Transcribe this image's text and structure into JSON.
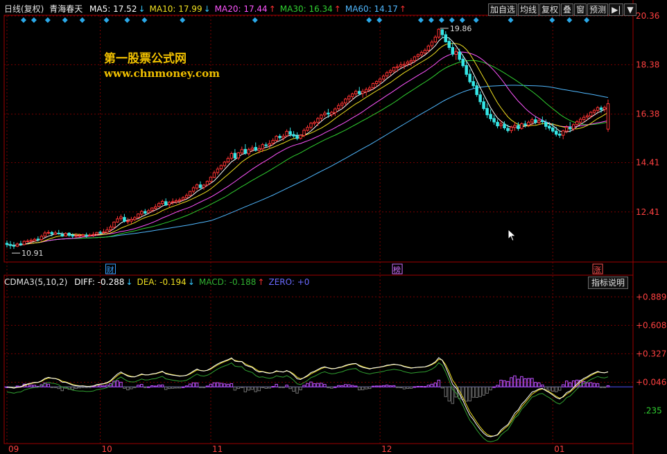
{
  "header": {
    "period_label": "日线(复权)",
    "stock_name": "青海春天",
    "ma_items": [
      {
        "label": "MA5: 17.52",
        "arrow": "↓",
        "color": "#ffffff",
        "arrow_color": "#35c9ff"
      },
      {
        "label": "MA10: 17.99",
        "arrow": "↓",
        "color": "#f0e020",
        "arrow_color": "#35c9ff"
      },
      {
        "label": "MA20: 17.44",
        "arrow": "↑",
        "color": "#ff55ff",
        "arrow_color": "#ff3030"
      },
      {
        "label": "MA30: 16.34",
        "arrow": "↑",
        "color": "#30d030",
        "arrow_color": "#ff3030"
      },
      {
        "label": "MA60: 14.17",
        "arrow": "↑",
        "color": "#50b8ff",
        "arrow_color": "#ff3030"
      }
    ]
  },
  "toolbar": {
    "buttons": [
      "加自选",
      "均线",
      "复权",
      "叠",
      "窗",
      "预测"
    ],
    "nav_icon": "arrow-right-bar-icon",
    "menu_icon": "dropdown-triangle-icon"
  },
  "promo": {
    "line1": "第一股票公式网",
    "line2": "www.chnmoney.com"
  },
  "price_axis": {
    "labels": [
      "20.36",
      "18.38",
      "16.38",
      "14.41",
      "12.41"
    ],
    "values": [
      20.36,
      18.38,
      16.38,
      14.41,
      12.41
    ],
    "range": [
      10.38,
      20.36
    ]
  },
  "annotations": {
    "high": {
      "text": "19.86",
      "value": 19.86
    },
    "low": {
      "text": "10.91",
      "value": 10.91
    }
  },
  "event_markers": [
    {
      "label": "财",
      "color": "#3aa0ff"
    },
    {
      "label": "榜",
      "color": "#d070ff"
    },
    {
      "label": "涨",
      "color": "#ff5050"
    }
  ],
  "indicator": {
    "name": "CDMA3(5,10,2)",
    "items": [
      {
        "label": "DIFF: -0.288",
        "arrow": "↓",
        "color": "#ffffff",
        "arrow_color": "#35c9ff"
      },
      {
        "label": "DEA: -0.194",
        "arrow": "↓",
        "color": "#f0e020",
        "arrow_color": "#35c9ff"
      },
      {
        "label": "MACD: -0.188",
        "arrow": "↑",
        "color": "#30b030",
        "arrow_color": "#ff3030"
      },
      {
        "label": "ZERO: +0",
        "arrow": "",
        "color": "#6a6aff",
        "arrow_color": "#6a6aff"
      }
    ],
    "explain_button": "指标说明",
    "axis": {
      "labels": [
        "+0.889",
        "+0.608",
        "+0.327",
        "+0.046"
      ],
      "values": [
        0.889,
        0.608,
        0.327,
        0.046
      ],
      "range": [
        -0.56,
        0.98
      ]
    },
    "extra_label": ".235"
  },
  "time_axis": {
    "labels": [
      "09",
      "10",
      "11",
      "12",
      "01"
    ],
    "label_index": [
      0,
      27,
      59,
      108,
      158
    ]
  },
  "colors": {
    "up": "#ff3232",
    "down": "#35e6e6",
    "grid": "#7a0000",
    "frame": "#a00000"
  },
  "chart_data": {
    "type": "candlestick",
    "title": "青海春天 日线(复权)",
    "candles": [
      [
        11.14,
        11.25,
        10.97,
        11.09
      ],
      [
        11.09,
        11.23,
        10.91,
        11.05
      ],
      [
        11.05,
        11.19,
        10.91,
        11.02
      ],
      [
        11.02,
        11.17,
        10.98,
        11.11
      ],
      [
        11.12,
        11.24,
        11.03,
        11.09
      ],
      [
        11.09,
        11.26,
        11.05,
        11.22
      ],
      [
        11.22,
        11.31,
        11.17,
        11.23
      ],
      [
        11.22,
        11.34,
        11.12,
        11.26
      ],
      [
        11.24,
        11.36,
        11.2,
        11.3
      ],
      [
        11.31,
        11.42,
        11.21,
        11.29
      ],
      [
        11.29,
        11.49,
        11.23,
        11.42
      ],
      [
        11.43,
        11.64,
        11.38,
        11.56
      ],
      [
        11.57,
        11.67,
        11.5,
        11.58
      ],
      [
        11.58,
        11.64,
        11.42,
        11.52
      ],
      [
        11.5,
        11.65,
        11.47,
        11.56
      ],
      [
        11.55,
        11.68,
        11.49,
        11.53
      ],
      [
        11.5,
        11.6,
        11.4,
        11.43
      ],
      [
        11.43,
        11.59,
        11.42,
        11.54
      ],
      [
        11.55,
        11.59,
        11.4,
        11.46
      ],
      [
        11.46,
        11.54,
        11.34,
        11.43
      ],
      [
        11.43,
        11.55,
        11.36,
        11.45
      ],
      [
        11.44,
        11.53,
        11.39,
        11.45
      ],
      [
        11.44,
        11.53,
        11.39,
        11.48
      ],
      [
        11.47,
        11.57,
        11.37,
        11.44
      ],
      [
        11.45,
        11.54,
        11.41,
        11.47
      ],
      [
        11.48,
        11.6,
        11.39,
        11.5
      ],
      [
        11.51,
        11.6,
        11.45,
        11.58
      ],
      [
        11.59,
        11.66,
        11.53,
        11.58
      ],
      [
        11.58,
        11.72,
        11.53,
        11.6
      ],
      [
        11.59,
        11.8,
        11.54,
        11.68
      ],
      [
        11.69,
        11.89,
        11.6,
        11.8
      ],
      [
        11.79,
        12.03,
        11.73,
        12.0
      ],
      [
        12.0,
        12.24,
        11.97,
        12.13
      ],
      [
        12.14,
        12.31,
        12.05,
        12.21
      ],
      [
        12.19,
        12.33,
        11.98,
        12.03
      ],
      [
        12.03,
        12.17,
        11.91,
        12.04
      ],
      [
        12.04,
        12.21,
        11.92,
        12.11
      ],
      [
        12.1,
        12.24,
        12.04,
        12.18
      ],
      [
        12.19,
        12.35,
        12.14,
        12.33
      ],
      [
        12.32,
        12.49,
        12.24,
        12.43
      ],
      [
        12.43,
        12.53,
        12.31,
        12.36
      ],
      [
        12.38,
        12.53,
        12.36,
        12.46
      ],
      [
        12.48,
        12.6,
        12.39,
        12.57
      ],
      [
        12.56,
        12.73,
        12.47,
        12.62
      ],
      [
        12.64,
        12.82,
        12.6,
        12.75
      ],
      [
        12.75,
        12.91,
        12.68,
        12.84
      ],
      [
        12.83,
        12.96,
        12.65,
        12.69
      ],
      [
        12.7,
        12.86,
        12.6,
        12.8
      ],
      [
        12.8,
        12.96,
        12.7,
        12.83
      ],
      [
        12.82,
        12.95,
        12.74,
        12.87
      ],
      [
        12.86,
        12.99,
        12.76,
        12.9
      ],
      [
        12.91,
        13.05,
        12.85,
        12.99
      ],
      [
        12.99,
        13.16,
        12.94,
        13.08
      ],
      [
        13.08,
        13.28,
        13.05,
        13.24
      ],
      [
        13.25,
        13.46,
        13.16,
        13.39
      ],
      [
        13.38,
        13.57,
        13.29,
        13.51
      ],
      [
        13.51,
        13.65,
        13.32,
        13.4
      ],
      [
        13.41,
        13.55,
        13.31,
        13.5
      ],
      [
        13.51,
        13.69,
        13.46,
        13.65
      ],
      [
        13.65,
        13.85,
        13.56,
        13.82
      ],
      [
        13.81,
        14.09,
        13.78,
        14.0
      ],
      [
        14.01,
        14.24,
        13.92,
        14.15
      ],
      [
        14.16,
        14.34,
        14.09,
        14.29
      ],
      [
        14.29,
        14.48,
        14.21,
        14.43
      ],
      [
        14.44,
        14.66,
        14.38,
        14.58
      ],
      [
        14.59,
        14.86,
        14.51,
        14.78
      ],
      [
        14.79,
        14.96,
        14.54,
        14.6
      ],
      [
        14.6,
        14.84,
        14.52,
        14.81
      ],
      [
        14.8,
        15.06,
        14.73,
        14.94
      ],
      [
        14.95,
        15.16,
        14.73,
        14.79
      ],
      [
        14.77,
        15.02,
        14.69,
        14.94
      ],
      [
        14.94,
        15.11,
        14.84,
        15.0
      ],
      [
        15.03,
        15.23,
        14.86,
        14.91
      ],
      [
        14.91,
        15.12,
        14.79,
        14.98
      ],
      [
        14.97,
        15.21,
        14.84,
        15.14
      ],
      [
        15.13,
        15.23,
        15.03,
        15.12
      ],
      [
        15.12,
        15.32,
        14.98,
        15.18
      ],
      [
        15.2,
        15.4,
        15.11,
        15.31
      ],
      [
        15.31,
        15.53,
        15.25,
        15.48
      ],
      [
        15.48,
        15.57,
        15.34,
        15.42
      ],
      [
        15.41,
        15.58,
        15.3,
        15.48
      ],
      [
        15.5,
        15.76,
        15.45,
        15.68
      ],
      [
        15.67,
        15.83,
        15.46,
        15.56
      ],
      [
        15.55,
        15.69,
        15.42,
        15.49
      ],
      [
        15.5,
        15.64,
        15.32,
        15.39
      ],
      [
        15.39,
        15.56,
        15.35,
        15.52
      ],
      [
        15.51,
        15.8,
        15.44,
        15.72
      ],
      [
        15.72,
        15.93,
        15.67,
        15.84
      ],
      [
        15.84,
        16.06,
        15.76,
        16.01
      ],
      [
        16.0,
        16.12,
        15.91,
        16.05
      ],
      [
        16.05,
        16.26,
        15.89,
        16.2
      ],
      [
        16.21,
        16.38,
        16.1,
        16.34
      ],
      [
        16.35,
        16.51,
        16.26,
        16.42
      ],
      [
        16.42,
        16.59,
        16.23,
        16.38
      ],
      [
        16.36,
        16.51,
        16.26,
        16.45
      ],
      [
        16.44,
        16.65,
        16.3,
        16.59
      ],
      [
        16.6,
        16.82,
        16.52,
        16.73
      ],
      [
        16.74,
        16.9,
        16.6,
        16.82
      ],
      [
        16.83,
        17.04,
        16.72,
        16.99
      ],
      [
        16.99,
        17.17,
        16.83,
        17.1
      ],
      [
        17.09,
        17.25,
        16.94,
        17.2
      ],
      [
        17.2,
        17.37,
        17.1,
        17.3
      ],
      [
        17.3,
        17.48,
        17.14,
        17.21
      ],
      [
        17.22,
        17.4,
        17.04,
        17.3
      ],
      [
        17.28,
        17.46,
        17.12,
        17.38
      ],
      [
        17.37,
        17.53,
        17.29,
        17.44
      ],
      [
        17.45,
        17.66,
        17.36,
        17.62
      ],
      [
        17.62,
        17.75,
        17.48,
        17.7
      ],
      [
        17.69,
        17.88,
        17.57,
        17.8
      ],
      [
        17.8,
        17.99,
        17.7,
        17.92
      ],
      [
        17.93,
        18.13,
        17.84,
        18.06
      ],
      [
        18.07,
        18.21,
        17.93,
        18.14
      ],
      [
        18.13,
        18.31,
        18.04,
        18.27
      ],
      [
        18.26,
        18.41,
        18.09,
        18.3
      ],
      [
        18.31,
        18.5,
        18.24,
        18.38
      ],
      [
        18.36,
        18.52,
        18.2,
        18.4
      ],
      [
        18.42,
        18.57,
        18.3,
        18.49
      ],
      [
        18.49,
        18.65,
        18.33,
        18.55
      ],
      [
        18.55,
        18.75,
        18.45,
        18.7
      ],
      [
        18.72,
        18.84,
        18.58,
        18.79
      ],
      [
        18.78,
        18.96,
        18.7,
        18.88
      ],
      [
        18.86,
        19.05,
        18.79,
        18.97
      ],
      [
        18.97,
        19.2,
        18.88,
        19.14
      ],
      [
        19.15,
        19.39,
        19.05,
        19.3
      ],
      [
        19.31,
        19.58,
        19.26,
        19.5
      ],
      [
        19.5,
        19.86,
        19.43,
        19.82
      ],
      [
        19.8,
        19.83,
        19.45,
        19.6
      ],
      [
        19.6,
        19.74,
        19.28,
        19.31
      ],
      [
        19.33,
        19.49,
        18.98,
        19.08
      ],
      [
        19.08,
        19.27,
        18.72,
        18.81
      ],
      [
        18.8,
        19.07,
        18.58,
        18.92
      ],
      [
        18.9,
        19.03,
        18.52,
        18.6
      ],
      [
        18.61,
        18.78,
        18.26,
        18.34
      ],
      [
        18.35,
        18.51,
        17.89,
        17.99
      ],
      [
        18.0,
        18.19,
        17.62,
        17.69
      ],
      [
        17.7,
        17.92,
        17.42,
        17.53
      ],
      [
        17.53,
        17.66,
        17.08,
        17.17
      ],
      [
        17.16,
        17.3,
        16.76,
        16.88
      ],
      [
        16.88,
        17.05,
        16.52,
        16.6
      ],
      [
        16.61,
        16.81,
        16.22,
        16.35
      ],
      [
        16.37,
        16.57,
        16.08,
        16.19
      ],
      [
        16.2,
        16.34,
        15.95,
        16.06
      ],
      [
        16.05,
        16.16,
        15.8,
        15.9
      ],
      [
        15.91,
        16.13,
        15.78,
        15.98
      ],
      [
        15.97,
        16.09,
        15.74,
        15.82
      ],
      [
        15.8,
        15.95,
        15.63,
        15.71
      ],
      [
        15.71,
        15.91,
        15.61,
        15.85
      ],
      [
        15.84,
        16.05,
        15.7,
        15.92
      ],
      [
        15.92,
        16.05,
        15.7,
        15.79
      ],
      [
        15.8,
        16.04,
        15.75,
        15.99
      ],
      [
        15.98,
        16.11,
        15.83,
        15.94
      ],
      [
        15.93,
        16.12,
        15.85,
        16.05
      ],
      [
        16.06,
        16.24,
        15.92,
        16.15
      ],
      [
        16.15,
        16.28,
        15.97,
        16.05
      ],
      [
        16.04,
        16.22,
        15.94,
        16.12
      ],
      [
        16.12,
        16.28,
        15.96,
        16.07
      ],
      [
        16.05,
        16.16,
        15.75,
        15.88
      ],
      [
        15.89,
        16.06,
        15.71,
        15.81
      ],
      [
        15.82,
        16.01,
        15.62,
        15.69
      ],
      [
        15.69,
        15.86,
        15.47,
        15.56
      ],
      [
        15.57,
        15.71,
        15.41,
        15.52
      ],
      [
        15.52,
        15.75,
        15.36,
        15.7
      ],
      [
        15.69,
        15.93,
        15.6,
        15.84
      ],
      [
        15.84,
        16.06,
        15.64,
        15.78
      ],
      [
        15.78,
        16.01,
        15.7,
        15.95
      ],
      [
        15.96,
        16.14,
        15.87,
        16.07
      ],
      [
        16.05,
        16.25,
        15.95,
        16.17
      ],
      [
        16.16,
        16.34,
        16.04,
        16.25
      ],
      [
        16.26,
        16.41,
        16.14,
        16.31
      ],
      [
        16.3,
        16.5,
        16.21,
        16.45
      ],
      [
        16.45,
        16.6,
        16.34,
        16.53
      ],
      [
        16.53,
        16.71,
        16.45,
        16.64
      ],
      [
        16.63,
        16.72,
        16.44,
        16.56
      ],
      [
        16.57,
        16.72,
        16.46,
        16.65
      ],
      [
        15.77,
        16.97,
        15.66,
        16.8
      ]
    ],
    "ma_lines": {
      "MA5": "derived from candles",
      "MA10": "derived",
      "MA20": "derived",
      "MA30": "derived",
      "MA60": "derived"
    },
    "ylim": [
      10.38,
      20.36
    ]
  }
}
